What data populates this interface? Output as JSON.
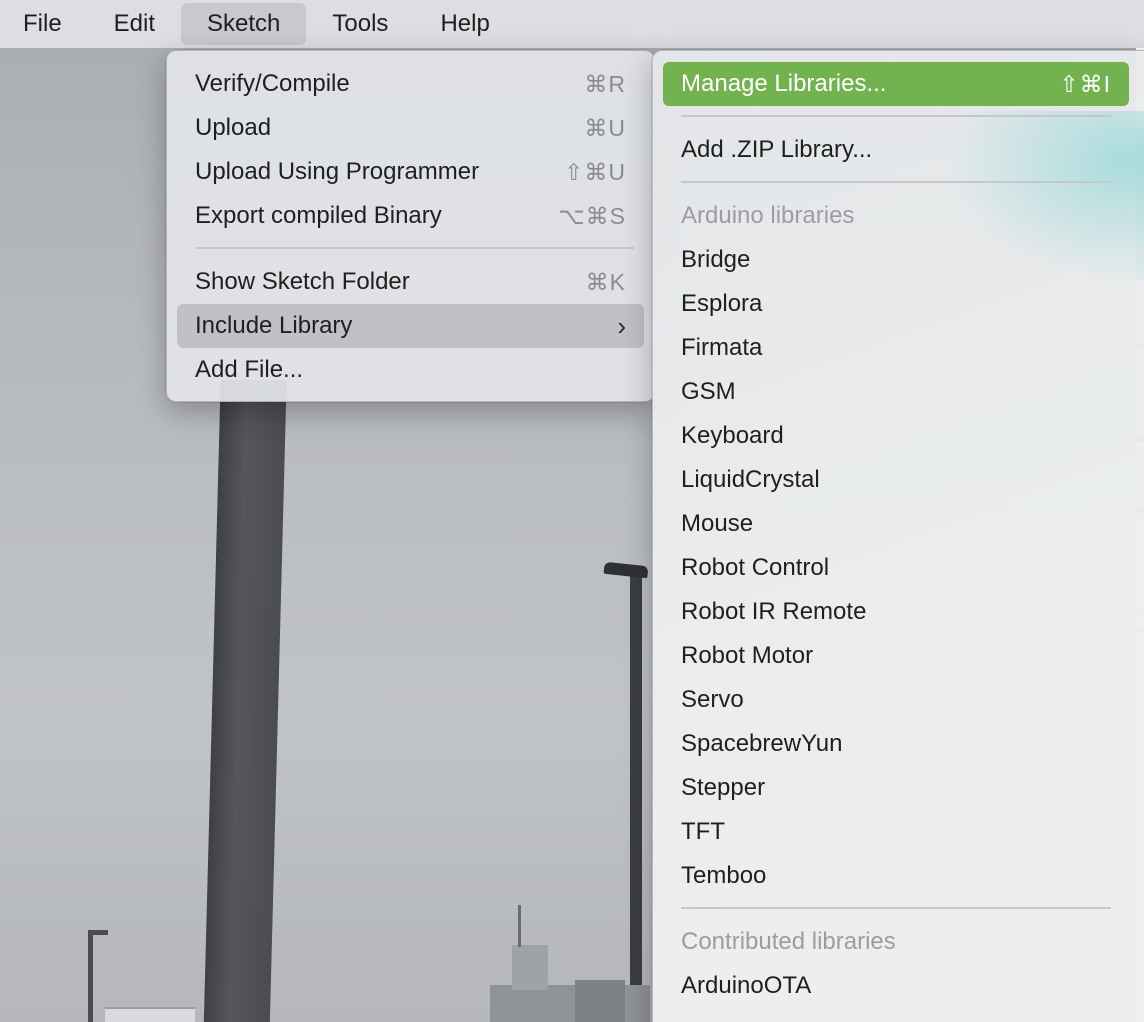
{
  "menubar": {
    "items": [
      "File",
      "Edit",
      "Sketch",
      "Tools",
      "Help"
    ],
    "active": "Sketch"
  },
  "sketch_menu": {
    "items": [
      {
        "label": "Verify/Compile",
        "shortcut": "⌘R"
      },
      {
        "label": "Upload",
        "shortcut": "⌘U"
      },
      {
        "label": "Upload Using Programmer",
        "shortcut": "⇧⌘U"
      },
      {
        "label": "Export compiled Binary",
        "shortcut": "⌥⌘S"
      },
      {
        "label": "Show Sketch Folder",
        "shortcut": "⌘K"
      },
      {
        "label": "Include Library",
        "shortcut": "›"
      },
      {
        "label": "Add File...",
        "shortcut": ""
      }
    ]
  },
  "library_menu": {
    "manage": {
      "label": "Manage Libraries...",
      "shortcut": "⇧⌘I"
    },
    "add_zip": "Add .ZIP Library...",
    "arduino_header": "Arduino libraries",
    "arduino_libraries": [
      "Bridge",
      "Esplora",
      "Firmata",
      "GSM",
      "Keyboard",
      "LiquidCrystal",
      "Mouse",
      "Robot Control",
      "Robot IR Remote",
      "Robot Motor",
      "Servo",
      "SpacebrewYun",
      "Stepper",
      "TFT",
      "Temboo"
    ],
    "contributed_header": "Contributed libraries",
    "contributed_libraries": [
      "ArduinoOTA"
    ]
  },
  "colors": {
    "selected_item": "#72b24f",
    "hover_item": "#bfc1c7",
    "header_text": "#9b9da2"
  }
}
